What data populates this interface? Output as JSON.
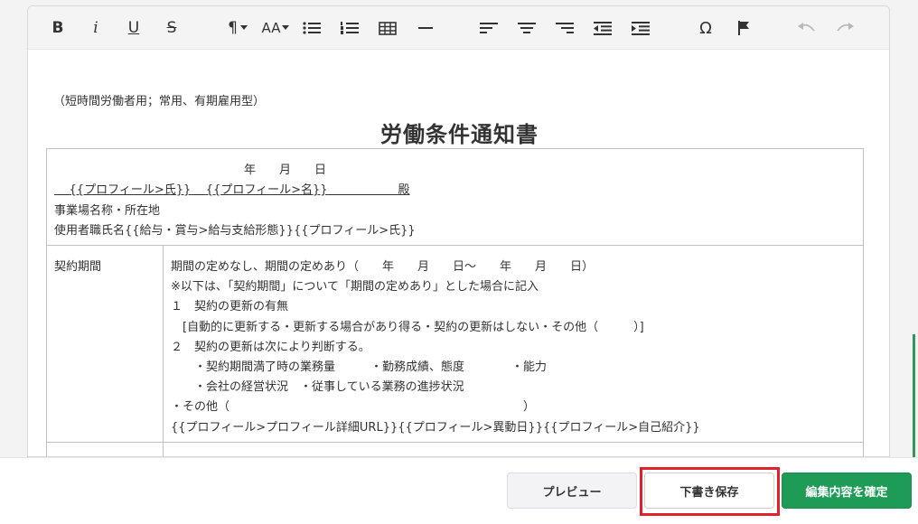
{
  "toolbar": {
    "bold": "B",
    "italic": "i",
    "underline": "U",
    "strike": "S",
    "paragraph": "¶",
    "font_size": "AA",
    "omega": "Ω"
  },
  "document": {
    "note": "（短時間労働者用；常用、有期雇用型）",
    "title": "労働条件通知書",
    "header": {
      "date_line": "年　　月　　日",
      "name_line_1": "{{プロフィール>氏}}",
      "name_line_2": "{{プロフィール>名}}",
      "honorific": "殿",
      "workplace": "事業場名称・所在地",
      "employer": "使用者職氏名{{給与・賞与>給与支給形態}}{{プロフィール>氏}}"
    },
    "contract": {
      "label": "契約期間",
      "lines": [
        "期間の定めなし、期間の定めあり（　　年　　月　　日～　　年　　月　　日）",
        "※以下は、「契約期間」について「期間の定めあり」とした場合に記入",
        "１　契約の更新の有無",
        "　[自動的に更新する・更新する場合があり得る・契約の更新はしない・その他（　　　）]",
        "２　契約の更新は次により判断する。",
        "　　・契約期間満了時の業務量　　　・勤務成績、態度　　　　・能力",
        "　　・会社の経営状況　・従事している業務の進捗状況",
        "・その他（　　　　　　　　　　　　　　　　　　　　　　　　　）",
        "{{プロフィール>プロフィール詳細URL}}{{プロフィール>異動日}}{{プロフィール>自己紹介}}"
      ]
    }
  },
  "footer": {
    "preview": "プレビュー",
    "save_draft": "下書き保存",
    "confirm": "編集内容を確定"
  },
  "colors": {
    "confirm_green": "#1f9b58",
    "highlight_red": "#e0202a"
  }
}
